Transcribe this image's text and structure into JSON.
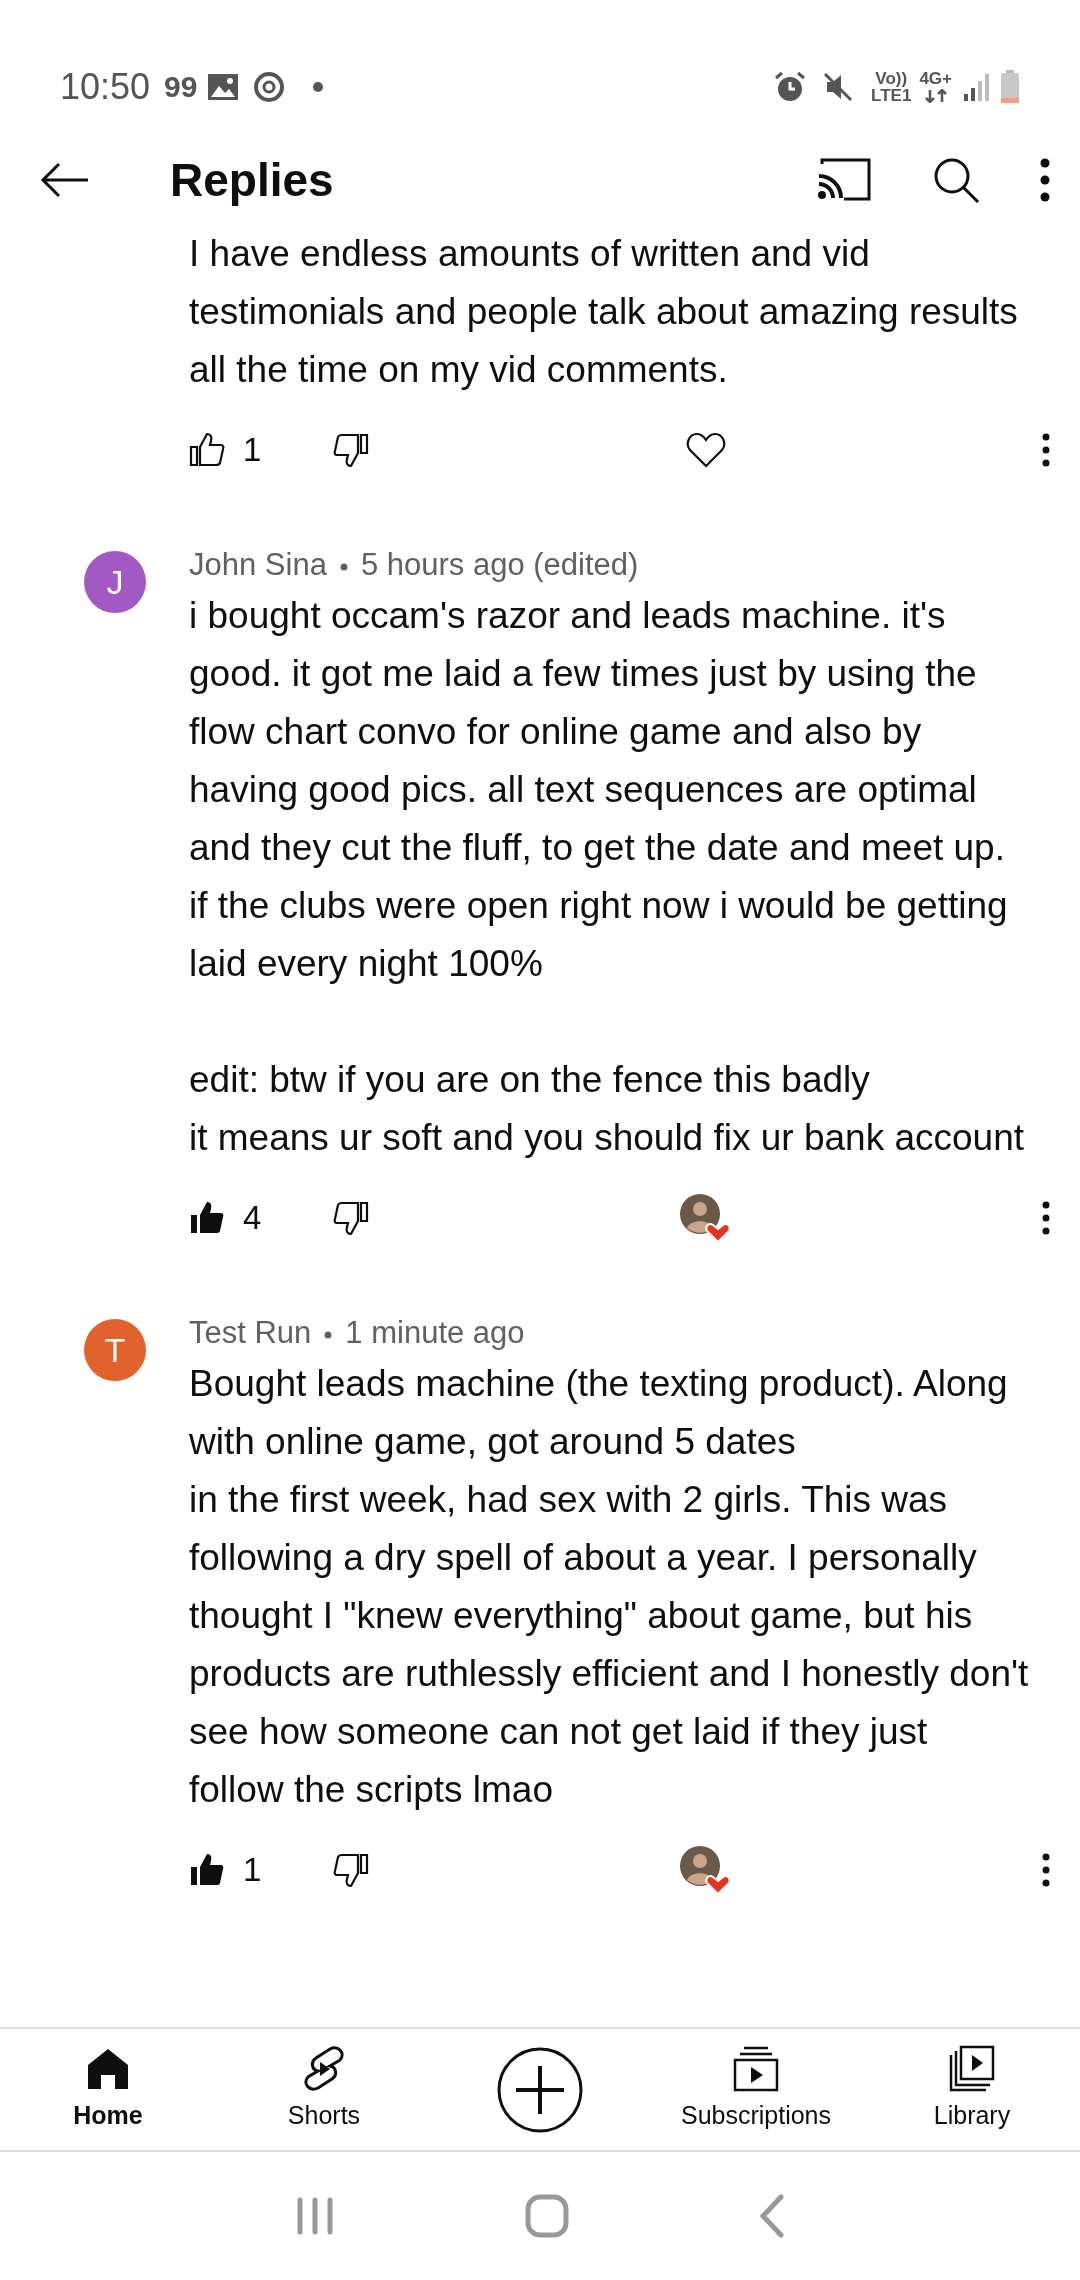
{
  "status_bar": {
    "time": "10:50",
    "badge": "99",
    "volte": "Vo))",
    "lte": "LTE1",
    "network": "4G+"
  },
  "header": {
    "title": "Replies"
  },
  "comments": [
    {
      "body": "I have endless amounts of written and vid testimonials and people talk about amazing results all the time on my vid comments.",
      "likes": "1",
      "liked": false,
      "creator_hearted": false
    },
    {
      "avatar": "J",
      "color": "#a259c4",
      "author": "John Sina",
      "time": "5 hours ago (edited)",
      "body": "i bought occam's razor and leads machine. it's good. it got me laid a few times just by using the flow chart convo for online game and also by having good pics. all text sequences are optimal and they cut the fluff, to get the date and meet up. if the clubs were open right now i would be getting laid every night 100%\n\nedit: btw if you are on the fence this badly\nit means ur soft and you should fix ur bank account",
      "likes": "4",
      "liked": true,
      "creator_hearted": true
    },
    {
      "avatar": "T",
      "color": "#e2622d",
      "author": "Test Run",
      "time": "1 minute ago",
      "body": "Bought leads machine (the texting product). Along with online game, got around 5 dates\nin the first week, had sex with 2 girls. This was following a dry spell of about a year. I personally thought I \"knew everything\" about game, but his products are ruthlessly efficient and I honestly don't see how someone can not get laid if they just follow the scripts lmao",
      "likes": "1",
      "liked": true,
      "creator_hearted": true
    }
  ],
  "bottom_nav": [
    {
      "kind": "home",
      "label": "Home",
      "selected": true
    },
    {
      "kind": "shorts",
      "label": "Shorts",
      "selected": false
    },
    {
      "kind": "create"
    },
    {
      "kind": "subscriptions",
      "label": "Subscriptions",
      "selected": false
    },
    {
      "kind": "library",
      "label": "Library",
      "selected": false
    }
  ]
}
